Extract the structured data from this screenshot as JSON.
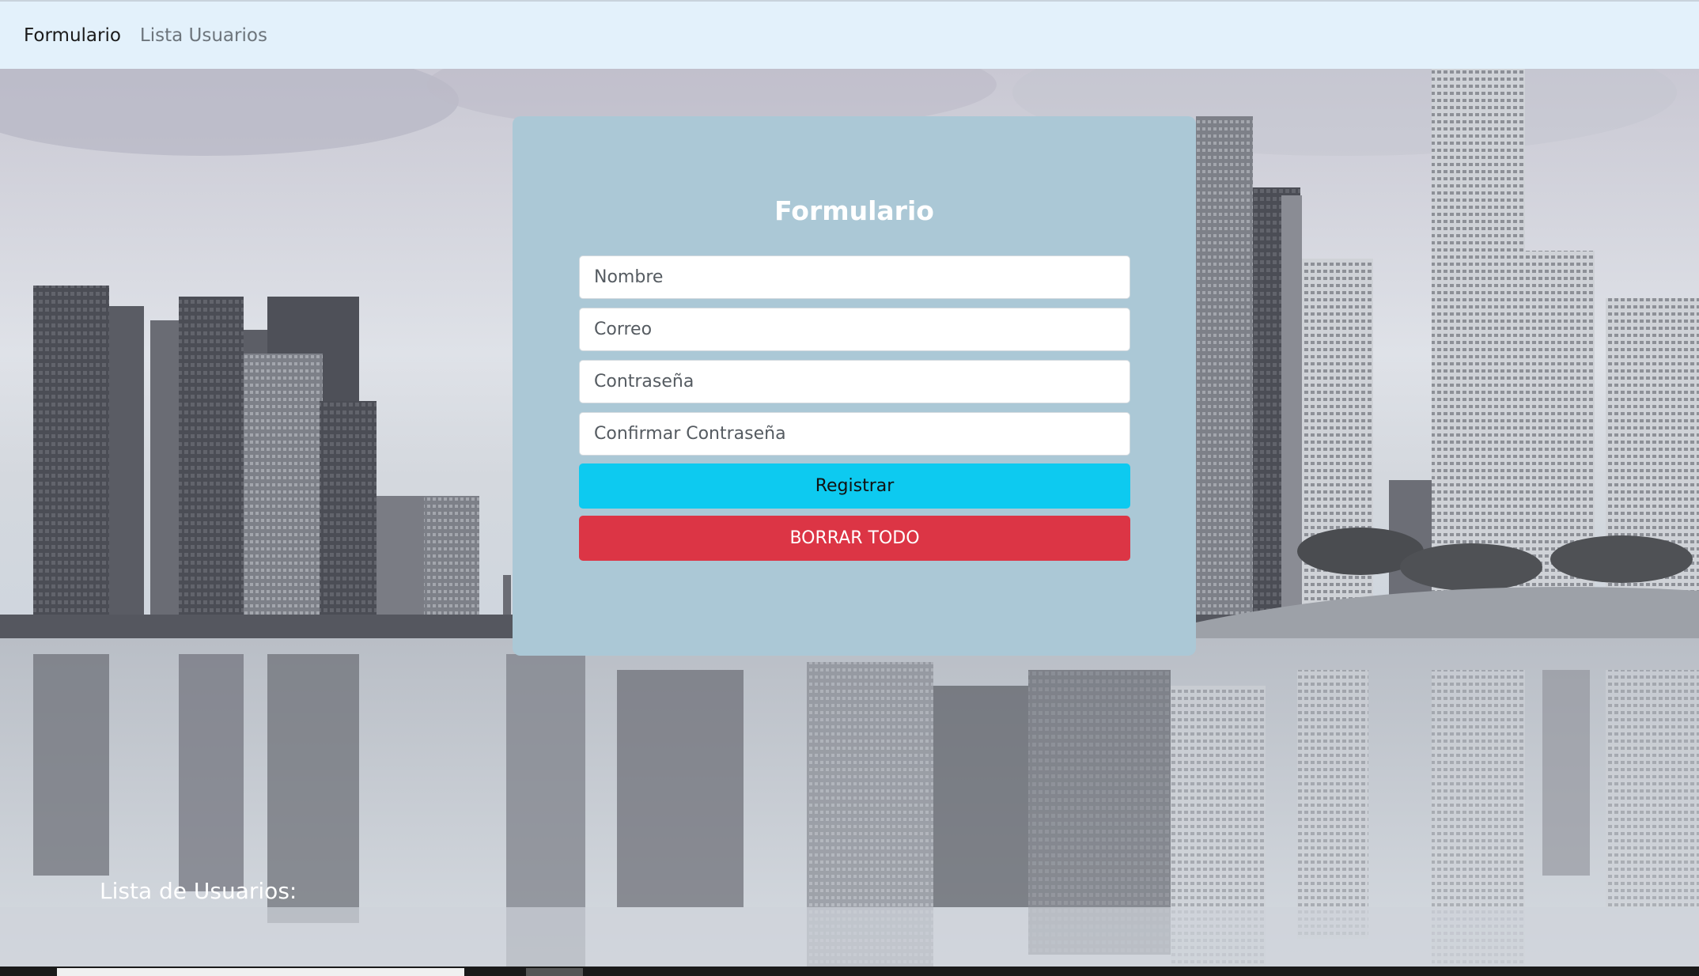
{
  "nav": {
    "links": [
      {
        "label": "Formulario",
        "active": true
      },
      {
        "label": "Lista Usuarios",
        "active": false
      }
    ]
  },
  "form": {
    "title": "Formulario",
    "fields": {
      "nombre": {
        "placeholder": "Nombre",
        "value": ""
      },
      "correo": {
        "placeholder": "Correo",
        "value": ""
      },
      "contrasena": {
        "placeholder": "Contraseña",
        "value": ""
      },
      "confirmar": {
        "placeholder": "Confirmar Contraseña",
        "value": ""
      }
    },
    "register_label": "Registrar",
    "clear_label": "BORRAR TODO"
  },
  "user_list": {
    "title": "Lista de Usuarios:"
  },
  "colors": {
    "navbar_bg": "#e3f1fb",
    "card_bg": "#abc8d6",
    "primary_button": "#0dcaf0",
    "danger_button": "#dc3545"
  }
}
